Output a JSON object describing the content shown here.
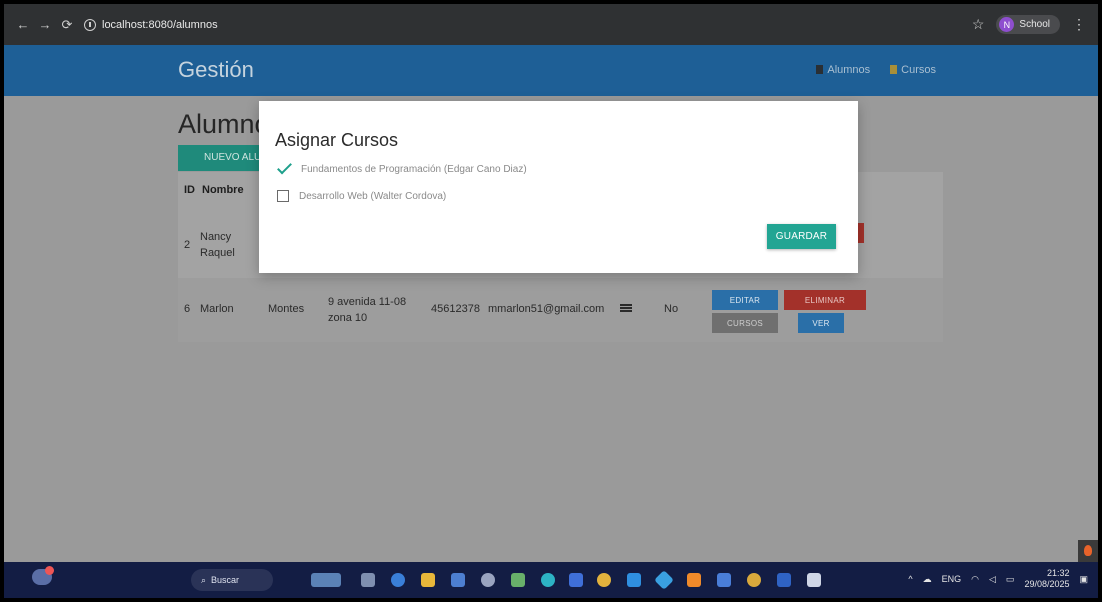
{
  "browser": {
    "url": "localhost:8080/alumnos",
    "profile_initial": "N",
    "profile_name": "School"
  },
  "app": {
    "brand": "Gestión",
    "nav": [
      {
        "label": "Alumnos"
      },
      {
        "label": "Cursos"
      }
    ],
    "page_title": "Alumnos",
    "new_button": "NUEVO ALUMNO",
    "table": {
      "headers": [
        "ID",
        "Nombre"
      ],
      "rows": [
        {
          "id": "2",
          "nombre": "Nancy Raquel",
          "apellido": "",
          "direccion": "",
          "telefono": "",
          "email": "",
          "activo": ""
        },
        {
          "id": "6",
          "nombre": "Marlon",
          "apellido": "Montes",
          "direccion": "9 avenida 11-08 zona 10",
          "telefono": "45612378",
          "email": "mmarlon51@gmail.com",
          "activo": "No"
        }
      ],
      "actions": {
        "edit": "EDITAR",
        "delete": "ELIMINAR",
        "courses": "CURSOS",
        "view": "VER"
      }
    }
  },
  "modal": {
    "title": "Asignar Cursos",
    "options": [
      {
        "label": "Fundamentos de Programación (Edgar Cano Diaz)",
        "checked": true
      },
      {
        "label": "Desarrollo Web (Walter Cordova)",
        "checked": false
      }
    ],
    "save_button": "GUARDAR"
  },
  "taskbar": {
    "search_placeholder": "Buscar",
    "lang": "ENG",
    "time": "21:32",
    "date": "29/08/2025"
  },
  "colors": {
    "primary": "#1e5f96",
    "accent": "#22a593",
    "danger": "#a3312a",
    "taskbar": "#131d44"
  }
}
